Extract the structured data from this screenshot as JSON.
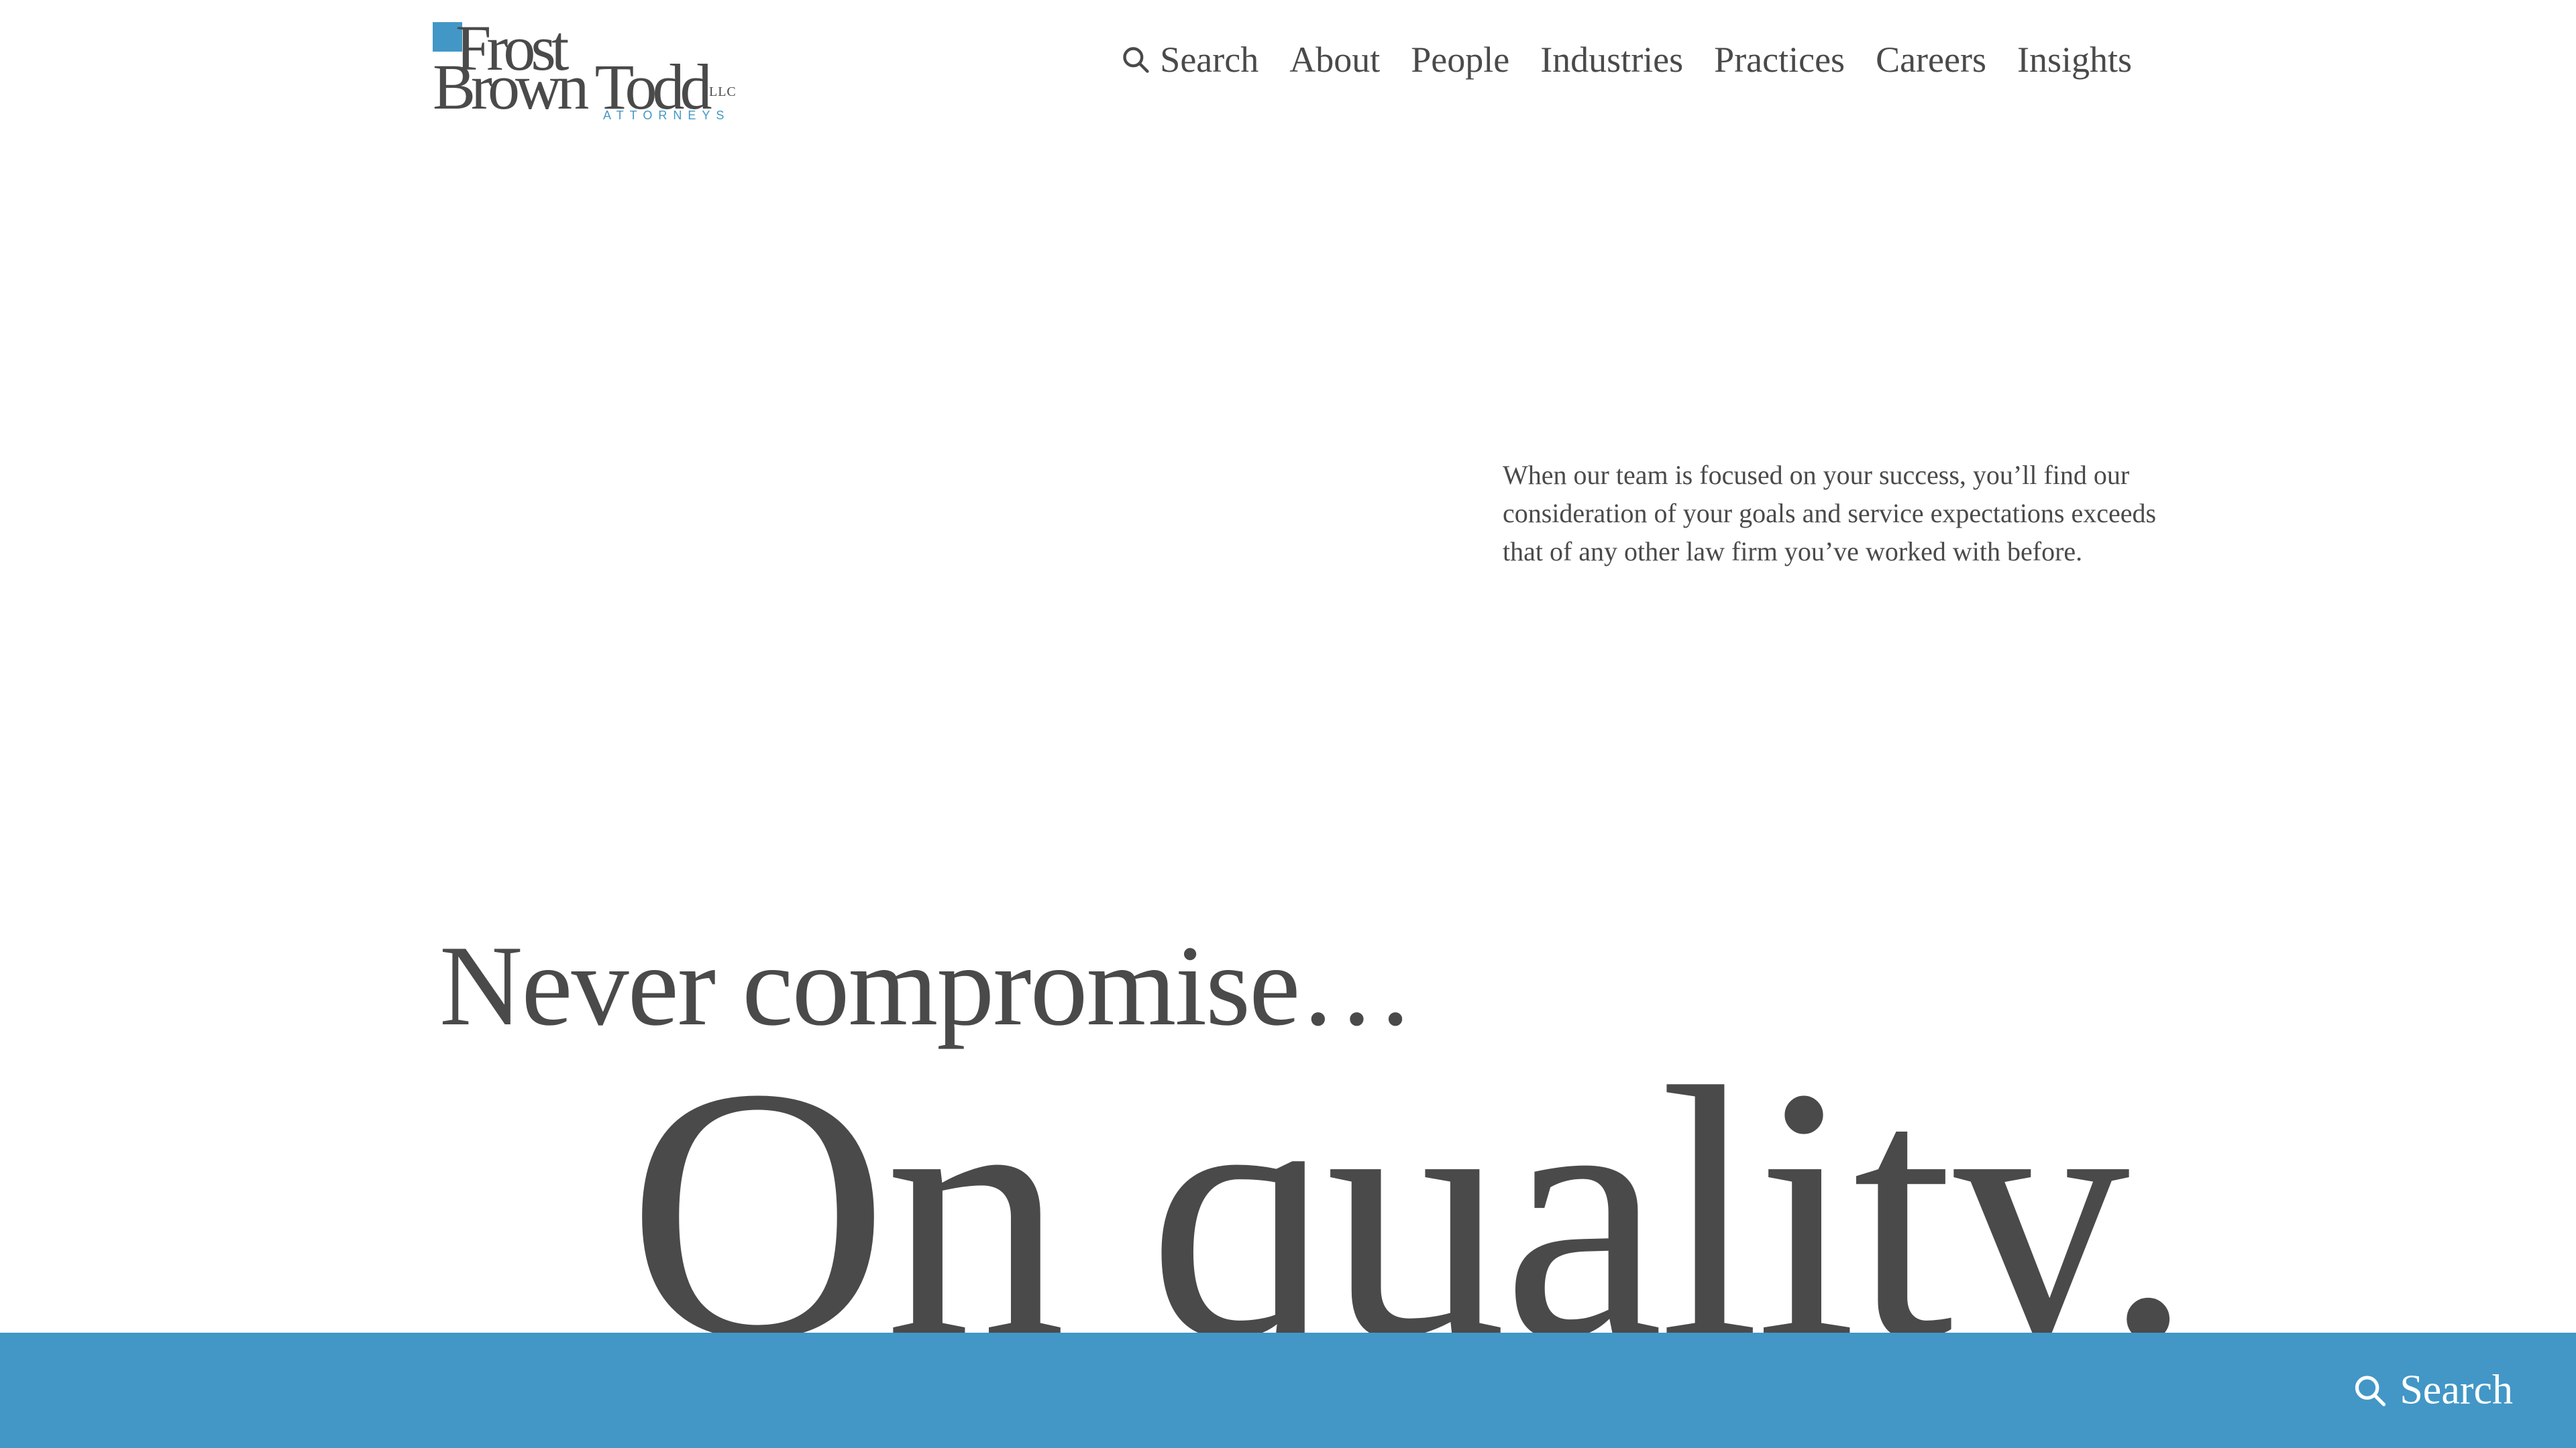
{
  "colors": {
    "text": "#4a4a4a",
    "accent": "#4297c6",
    "background": "#ffffff",
    "bar_text": "#ffffff"
  },
  "logo": {
    "line1": "Frost",
    "line2": "Brown Todd",
    "suffix": "LLC",
    "tagline": "ATTORNEYS"
  },
  "nav": {
    "search_icon": "search-icon",
    "search_label": "Search",
    "items": [
      "About",
      "People",
      "Industries",
      "Practices",
      "Careers",
      "Insights"
    ]
  },
  "intro": {
    "text": "When our team is focused on your success, you’ll find our consideration of your goals and service expectations exceeds that of any other law firm you’ve worked with before."
  },
  "hero": {
    "kicker": "Never compromise…",
    "headline": "On quality."
  },
  "bottom_bar": {
    "search_icon": "search-icon",
    "search_label": "Search"
  }
}
